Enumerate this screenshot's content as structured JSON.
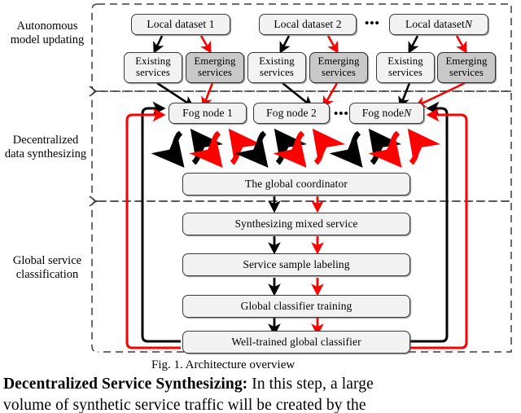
{
  "figure": {
    "caption": "Fig. 1.  Architecture overview",
    "stages": [
      {
        "id": "autonomous-model-updating",
        "line1": "Autonomous",
        "line2": "model updating"
      },
      {
        "id": "decentralized-data-synthesizing",
        "line1": "Decentralized",
        "line2": "data synthesizing"
      },
      {
        "id": "global-service-classification",
        "line1": "Global service",
        "line2": "classification"
      }
    ],
    "datasets": [
      {
        "id": "local-dataset-1",
        "label": "Local dataset 1"
      },
      {
        "id": "local-dataset-2",
        "label": "Local dataset 2"
      },
      {
        "id": "local-dataset-n",
        "label": "Local dataset ",
        "italic": "N"
      }
    ],
    "dataset_ellipsis": "•••",
    "services": [
      {
        "id": "existing-services-1",
        "line1": "Existing",
        "line2": "services",
        "emphasis": "light"
      },
      {
        "id": "emerging-services-1",
        "line1": "Emerging",
        "line2": "services",
        "emphasis": "dark"
      },
      {
        "id": "existing-services-2",
        "line1": "Existing",
        "line2": "services",
        "emphasis": "light"
      },
      {
        "id": "emerging-services-2",
        "line1": "Emerging",
        "line2": "services",
        "emphasis": "dark"
      },
      {
        "id": "existing-services-n",
        "line1": "Existing",
        "line2": "services",
        "emphasis": "light"
      },
      {
        "id": "emerging-services-n",
        "line1": "Emerging",
        "line2": "services",
        "emphasis": "dark"
      }
    ],
    "fog_nodes": [
      {
        "id": "fog-node-1",
        "label": "Fog node 1"
      },
      {
        "id": "fog-node-2",
        "label": "Fog node 2"
      },
      {
        "id": "fog-node-n",
        "label": "Fog node ",
        "italic": "N"
      }
    ],
    "fog_ellipsis": "•••",
    "coordinator": {
      "id": "the-global-coordinator",
      "label": "The global coordinator"
    },
    "pipeline": [
      {
        "id": "synthesizing-mixed-service",
        "label": "Synthesizing mixed service"
      },
      {
        "id": "service-sample-labeling",
        "label": "Service sample labeling"
      },
      {
        "id": "global-classifier-training",
        "label": "Global classifier training"
      },
      {
        "id": "well-trained-global-classifier",
        "label": "Well-trained global classifier"
      }
    ],
    "colors": {
      "existing_flow": "#000000",
      "emerging_flow": "#ff0000",
      "box_fill_light": "#f2f2f2",
      "box_fill_dark": "#c9c9c9",
      "box_stroke": "#3a3a3a",
      "group_boundary": "#404040"
    }
  },
  "page_text": {
    "paragraph_lead_bold": "Decentralized Service Synthesizing:",
    "paragraph_line1_rest": " In this step, a large",
    "paragraph_line2": "volume of synthetic service traffic will be created by the"
  }
}
